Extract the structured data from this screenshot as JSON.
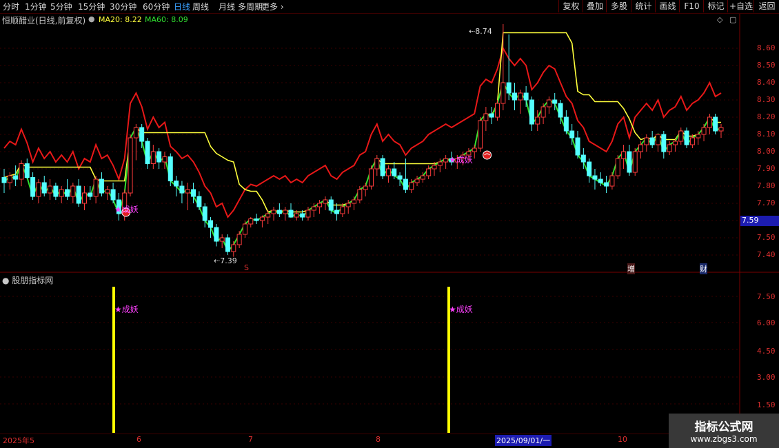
{
  "toolbar": {
    "periods": [
      "分时",
      "1分钟",
      "5分钟",
      "15分钟",
      "30分钟",
      "60分钟",
      "日线",
      "周线",
      "月线",
      "多周期",
      "更多"
    ],
    "active_period": "日线",
    "right_buttons": [
      "复权",
      "叠加",
      "多股",
      "统计",
      "画线",
      "F10",
      "标记",
      "+自选",
      "返回"
    ]
  },
  "header": {
    "stock": "恒顺醋业(日线,前复权)",
    "ma20_label": "MA20: 8.22",
    "ma60_label": "MA60: 8.09"
  },
  "price_axis": {
    "ticks": [
      "8.60",
      "8.50",
      "8.40",
      "8.30",
      "8.20",
      "8.10",
      "8.00",
      "7.90",
      "7.80",
      "7.70",
      "7.60",
      "7.50",
      "7.40"
    ],
    "current_price": "7.59"
  },
  "annotations": {
    "high": "8.74",
    "low": "7.39",
    "signal_1": "★成妖",
    "signal_2": "★成妖",
    "marker_s": "S",
    "marker_zeng": "增",
    "marker_cai": "财"
  },
  "indicator": {
    "title": "股朋指标网",
    "ticks": [
      "7.50",
      "6.00",
      "4.50",
      "3.00",
      "1.50"
    ],
    "signal_1": "★成妖",
    "signal_2": "★成妖"
  },
  "xaxis": {
    "labels": [
      "2025年5",
      "6",
      "7",
      "8",
      "9",
      "10"
    ],
    "cursor_date": "2025/09/01/一"
  },
  "watermark": {
    "line1": "指标公式网",
    "line2": "www.zbgs3.com"
  },
  "colors": {
    "up": "#ff3c3c",
    "down": "#54ffff",
    "upper_band": "#e81818",
    "mid_line": "#ffff3c",
    "lower_band": "#30e030",
    "signal_bar": "#ffff00",
    "signal_text": "#ff40ff"
  },
  "chart_data": {
    "type": "candlestick",
    "ylim": [
      7.36,
      8.74
    ],
    "candles": [
      [
        7.85,
        7.9,
        7.76,
        7.82
      ],
      [
        7.82,
        7.88,
        7.78,
        7.86
      ],
      [
        7.86,
        7.92,
        7.8,
        7.84
      ],
      [
        7.84,
        7.95,
        7.8,
        7.93
      ],
      [
        7.93,
        7.96,
        7.84,
        7.85
      ],
      [
        7.85,
        7.88,
        7.72,
        7.74
      ],
      [
        7.74,
        7.84,
        7.7,
        7.82
      ],
      [
        7.82,
        7.86,
        7.74,
        7.76
      ],
      [
        7.76,
        7.84,
        7.72,
        7.8
      ],
      [
        7.8,
        7.82,
        7.72,
        7.74
      ],
      [
        7.74,
        7.8,
        7.7,
        7.78
      ],
      [
        7.78,
        7.84,
        7.72,
        7.74
      ],
      [
        7.74,
        7.82,
        7.7,
        7.8
      ],
      [
        7.8,
        7.84,
        7.68,
        7.7
      ],
      [
        7.7,
        7.8,
        7.66,
        7.76
      ],
      [
        7.76,
        7.8,
        7.72,
        7.74
      ],
      [
        7.74,
        7.86,
        7.7,
        7.84
      ],
      [
        7.84,
        7.88,
        7.74,
        7.76
      ],
      [
        7.76,
        7.8,
        7.72,
        7.78
      ],
      [
        7.78,
        7.82,
        7.7,
        7.72
      ],
      [
        7.72,
        7.76,
        7.6,
        7.64
      ],
      [
        7.64,
        7.78,
        7.6,
        7.76
      ],
      [
        7.76,
        8.1,
        7.74,
        8.08
      ],
      [
        8.08,
        8.16,
        7.95,
        8.14
      ],
      [
        8.14,
        8.16,
        8.02,
        8.06
      ],
      [
        8.06,
        8.08,
        7.9,
        7.93
      ],
      [
        7.93,
        8.04,
        7.9,
        8.0
      ],
      [
        8.0,
        8.02,
        7.9,
        7.94
      ],
      [
        7.94,
        8.0,
        7.9,
        7.97
      ],
      [
        7.97,
        7.99,
        7.8,
        7.83
      ],
      [
        7.83,
        7.86,
        7.74,
        7.8
      ],
      [
        7.8,
        7.83,
        7.7,
        7.76
      ],
      [
        7.76,
        7.82,
        7.66,
        7.78
      ],
      [
        7.78,
        7.82,
        7.7,
        7.74
      ],
      [
        7.74,
        7.77,
        7.66,
        7.68
      ],
      [
        7.68,
        7.7,
        7.56,
        7.6
      ],
      [
        7.6,
        7.62,
        7.5,
        7.56
      ],
      [
        7.56,
        7.58,
        7.45,
        7.48
      ],
      [
        7.48,
        7.52,
        7.44,
        7.5
      ],
      [
        7.5,
        7.52,
        7.4,
        7.42
      ],
      [
        7.42,
        7.48,
        7.39,
        7.46
      ],
      [
        7.46,
        7.54,
        7.44,
        7.52
      ],
      [
        7.52,
        7.6,
        7.5,
        7.58
      ],
      [
        7.58,
        7.62,
        7.56,
        7.61
      ],
      [
        7.61,
        7.64,
        7.58,
        7.6
      ],
      [
        7.6,
        7.63,
        7.56,
        7.62
      ],
      [
        7.62,
        7.66,
        7.58,
        7.64
      ],
      [
        7.64,
        7.68,
        7.6,
        7.66
      ],
      [
        7.66,
        7.7,
        7.62,
        7.64
      ],
      [
        7.64,
        7.68,
        7.6,
        7.66
      ],
      [
        7.66,
        7.7,
        7.62,
        7.62
      ],
      [
        7.62,
        7.66,
        7.6,
        7.64
      ],
      [
        7.64,
        7.66,
        7.6,
        7.62
      ],
      [
        7.62,
        7.68,
        7.6,
        7.66
      ],
      [
        7.66,
        7.7,
        7.62,
        7.68
      ],
      [
        7.68,
        7.72,
        7.64,
        7.7
      ],
      [
        7.7,
        7.74,
        7.66,
        7.72
      ],
      [
        7.72,
        7.74,
        7.64,
        7.66
      ],
      [
        7.66,
        7.7,
        7.6,
        7.64
      ],
      [
        7.64,
        7.7,
        7.62,
        7.68
      ],
      [
        7.68,
        7.72,
        7.64,
        7.7
      ],
      [
        7.7,
        7.74,
        7.66,
        7.72
      ],
      [
        7.72,
        7.8,
        7.7,
        7.78
      ],
      [
        7.78,
        7.82,
        7.74,
        7.8
      ],
      [
        7.8,
        7.92,
        7.78,
        7.9
      ],
      [
        7.9,
        7.98,
        7.86,
        7.96
      ],
      [
        7.96,
        7.98,
        7.84,
        7.86
      ],
      [
        7.86,
        7.92,
        7.82,
        7.9
      ],
      [
        7.9,
        7.94,
        7.84,
        7.86
      ],
      [
        7.86,
        7.88,
        7.8,
        7.84
      ],
      [
        7.84,
        7.96,
        7.76,
        7.78
      ],
      [
        7.78,
        7.84,
        7.76,
        7.82
      ],
      [
        7.82,
        7.86,
        7.8,
        7.84
      ],
      [
        7.84,
        7.88,
        7.82,
        7.86
      ],
      [
        7.86,
        7.92,
        7.84,
        7.9
      ],
      [
        7.9,
        7.94,
        7.86,
        7.92
      ],
      [
        7.92,
        7.96,
        7.88,
        7.94
      ],
      [
        7.94,
        7.98,
        7.9,
        7.96
      ],
      [
        7.96,
        8.0,
        7.92,
        7.94
      ],
      [
        7.94,
        7.98,
        7.9,
        7.96
      ],
      [
        7.96,
        8.0,
        7.92,
        7.98
      ],
      [
        7.98,
        8.02,
        7.94,
        8.0
      ],
      [
        8.0,
        8.04,
        7.96,
        8.02
      ],
      [
        8.02,
        8.2,
        8.0,
        8.18
      ],
      [
        8.18,
        8.26,
        8.12,
        8.22
      ],
      [
        8.22,
        8.26,
        8.16,
        8.2
      ],
      [
        8.2,
        8.3,
        8.18,
        8.28
      ],
      [
        8.28,
        8.74,
        8.24,
        8.4
      ],
      [
        8.4,
        8.68,
        8.3,
        8.34
      ],
      [
        8.34,
        8.4,
        8.24,
        8.3
      ],
      [
        8.3,
        8.36,
        8.22,
        8.34
      ],
      [
        8.34,
        8.38,
        8.26,
        8.3
      ],
      [
        8.3,
        8.32,
        8.12,
        8.16
      ],
      [
        8.16,
        8.24,
        8.12,
        8.2
      ],
      [
        8.2,
        8.28,
        8.16,
        8.26
      ],
      [
        8.26,
        8.32,
        8.22,
        8.3
      ],
      [
        8.3,
        8.34,
        8.24,
        8.28
      ],
      [
        8.28,
        8.3,
        8.16,
        8.2
      ],
      [
        8.2,
        8.24,
        8.1,
        8.12
      ],
      [
        8.12,
        8.16,
        8.04,
        8.08
      ],
      [
        8.08,
        8.12,
        7.96,
        7.98
      ],
      [
        7.98,
        8.02,
        7.9,
        7.94
      ],
      [
        7.94,
        7.96,
        7.82,
        7.86
      ],
      [
        7.86,
        7.9,
        7.78,
        7.84
      ],
      [
        7.84,
        7.88,
        7.8,
        7.82
      ],
      [
        7.82,
        7.86,
        7.76,
        7.8
      ],
      [
        7.8,
        7.88,
        7.78,
        7.86
      ],
      [
        7.86,
        7.98,
        7.84,
        7.96
      ],
      [
        7.96,
        8.04,
        7.9,
        8.0
      ],
      [
        8.0,
        8.04,
        7.86,
        7.88
      ],
      [
        7.88,
        8.02,
        7.86,
        8.0
      ],
      [
        8.0,
        8.06,
        7.96,
        8.04
      ],
      [
        8.04,
        8.1,
        8.0,
        8.08
      ],
      [
        8.08,
        8.12,
        8.02,
        8.04
      ],
      [
        8.04,
        8.1,
        8.0,
        8.1
      ],
      [
        8.1,
        8.12,
        7.96,
        8.0
      ],
      [
        8.0,
        8.06,
        7.98,
        8.04
      ],
      [
        8.04,
        8.08,
        8.0,
        8.06
      ],
      [
        8.06,
        8.14,
        8.04,
        8.12
      ],
      [
        8.12,
        8.14,
        8.02,
        8.04
      ],
      [
        8.04,
        8.1,
        8.02,
        8.08
      ],
      [
        8.08,
        8.12,
        8.04,
        8.1
      ],
      [
        8.1,
        8.16,
        8.06,
        8.14
      ],
      [
        8.14,
        8.22,
        8.1,
        8.2
      ],
      [
        8.2,
        8.22,
        8.1,
        8.12
      ],
      [
        8.12,
        8.16,
        8.08,
        8.14
      ]
    ],
    "signal_candle_indexes": [
      21,
      83
    ]
  }
}
